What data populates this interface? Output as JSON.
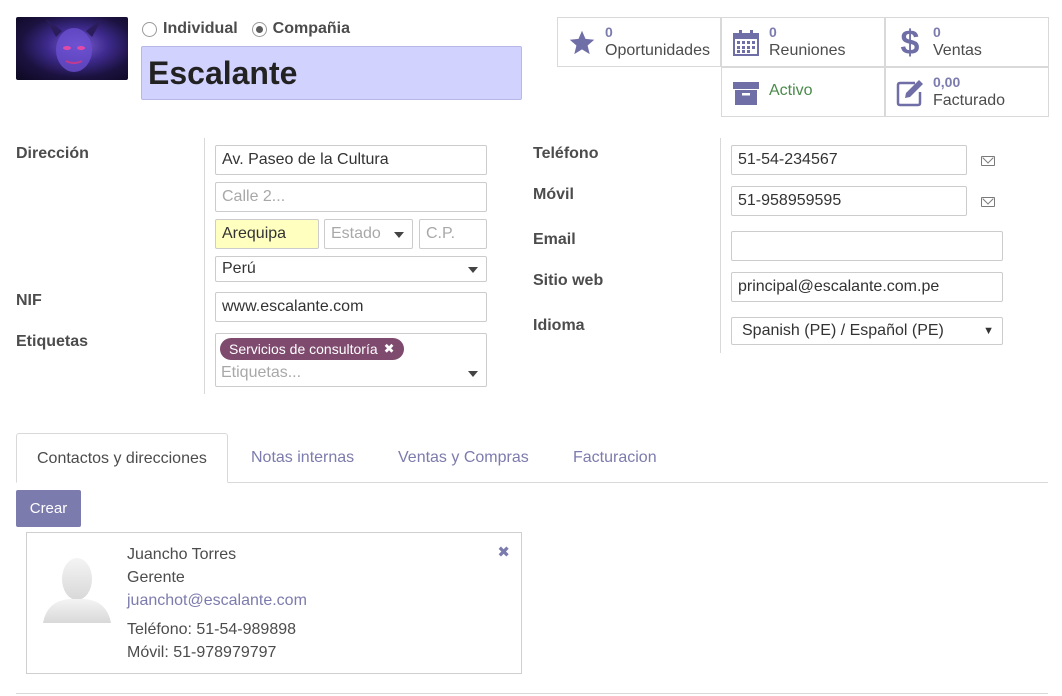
{
  "partner": {
    "type_options": [
      "Individual",
      "Compañia"
    ],
    "selected_type": "Compañia",
    "name": "Escalante"
  },
  "smart_buttons": {
    "opportunities": {
      "count": "0",
      "label": "Oportunidades",
      "icon": "star-icon"
    },
    "meetings": {
      "count": "0",
      "label": "Reuniones",
      "icon": "calendar-icon"
    },
    "sales": {
      "count": "0",
      "label": "Ventas",
      "icon": "dollar-icon"
    },
    "active": {
      "label": "Activo",
      "icon": "archive-icon"
    },
    "invoiced": {
      "count": "0,00",
      "label": "Facturado",
      "icon": "edit-icon"
    }
  },
  "labels": {
    "address": "Dirección",
    "vat": "NIF",
    "tags": "Etiquetas",
    "phone": "Teléfono",
    "mobile": "Móvil",
    "email": "Email",
    "website": "Sitio web",
    "language": "Idioma"
  },
  "address": {
    "street": "Av. Paseo de la Cultura",
    "street2_placeholder": "Calle 2...",
    "city": "Arequipa",
    "state_placeholder": "Estado",
    "zip_placeholder": "C.P.",
    "country": "Perú"
  },
  "vat_value": "www.escalante.com",
  "tags": {
    "items": [
      "Servicios de consultoría"
    ],
    "placeholder": "Etiquetas..."
  },
  "contact_fields": {
    "phone": "51-54-234567",
    "mobile": "51-958959595",
    "email": "",
    "website": "principal@escalante.com.pe",
    "language": "Spanish (PE) / Español (PE)"
  },
  "tabs": [
    {
      "label": "Contactos y direcciones",
      "active": true
    },
    {
      "label": "Notas internas",
      "active": false
    },
    {
      "label": "Ventas y Compras",
      "active": false
    },
    {
      "label": "Facturacion",
      "active": false
    }
  ],
  "create_button": "Crear",
  "contacts": [
    {
      "name": "Juancho Torres",
      "function": "Gerente",
      "email": "juanchot@escalante.com",
      "phone": "Teléfono: 51-54-989898",
      "mobile": "Móvil: 51-978979797"
    }
  ],
  "colors": {
    "accent": "#7c7bad",
    "name_field_bg": "#d2d2ff",
    "tag_bg": "#7e4a6e",
    "active_green": "#4a8a4a",
    "city_highlight": "#ffffc0"
  }
}
